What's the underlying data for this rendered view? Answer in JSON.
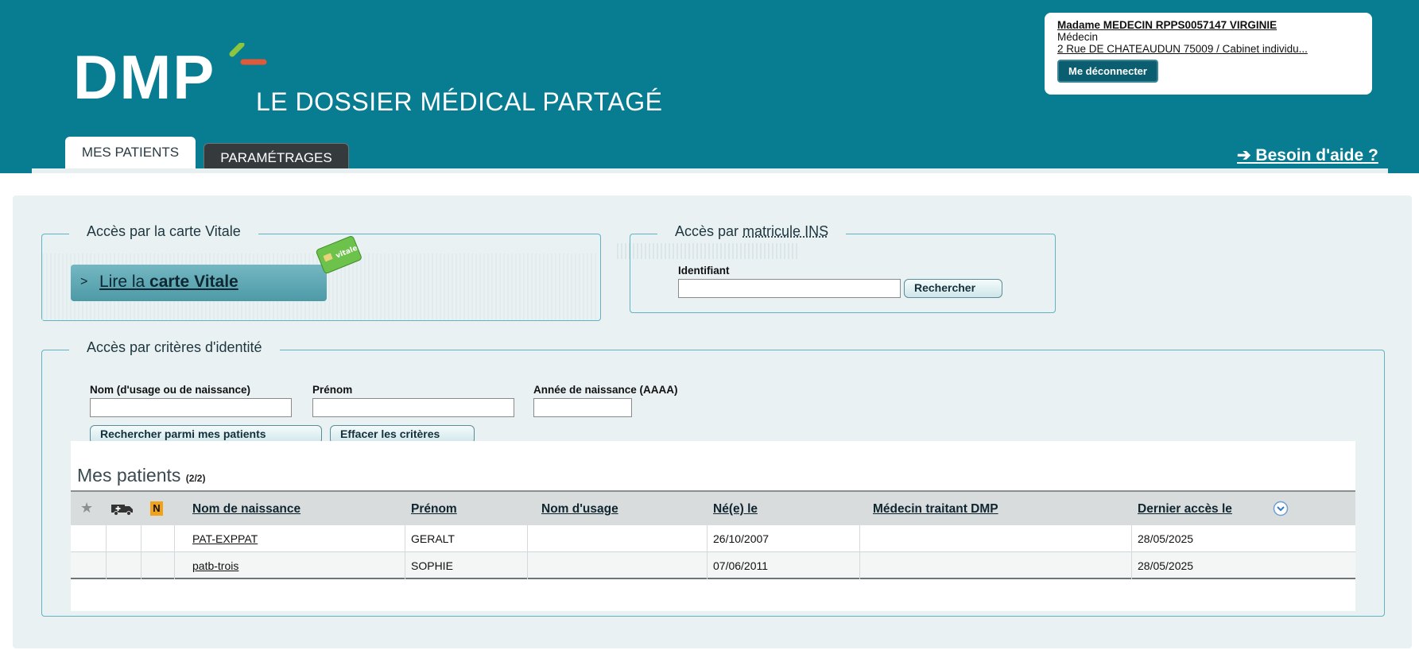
{
  "header": {
    "logo_text": "DMP",
    "tagline": "LE DOSSIER MÉDICAL PARTAGÉ",
    "brand_color": "#087d92",
    "accent_colors": [
      "#e05a3a",
      "#8cc63f"
    ],
    "tabs": [
      {
        "label": "MES PATIENTS",
        "active": true
      },
      {
        "label": "PARAMÉTRAGES",
        "active": false
      }
    ],
    "help_link": "➔ Besoin d'aide ?"
  },
  "user": {
    "name": "Madame MEDECIN RPPS0057147 VIRGINIE",
    "role": "Médecin",
    "address": "2 Rue DE CHATEAUDUN 75009 / Cabinet individu...",
    "logout_label": "Me déconnecter"
  },
  "vitale": {
    "legend": "Accès par la carte Vitale",
    "button_prefix": "Lire la ",
    "button_strong": "carte Vitale",
    "card_text": "vitale"
  },
  "ins": {
    "legend_prefix": "Accès par ",
    "legend_underlined": "matricule INS",
    "id_label": "Identifiant",
    "id_value": "",
    "search_label": "Rechercher"
  },
  "identity": {
    "legend": "Accès par critères d'identité",
    "fields": {
      "nom_label": "Nom (d'usage ou de naissance)",
      "nom_value": "",
      "prenom_label": "Prénom",
      "prenom_value": "",
      "annee_label": "Année de naissance (AAAA)",
      "annee_value": ""
    },
    "search_button": "Rechercher parmi mes patients",
    "clear_button": "Effacer les critères"
  },
  "results": {
    "title": "Mes patients",
    "count": "(2/2)",
    "columns": {
      "favorite": "★",
      "n_badge": "N",
      "nom_naissance": "Nom de naissance",
      "prenom": "Prénom",
      "nom_usage": "Nom d'usage",
      "ne_le": "Né(e) le",
      "medecin": "Médecin traitant DMP",
      "dernier_acces": "Dernier accès le"
    },
    "rows": [
      {
        "nom_naissance": "PAT-EXPPAT",
        "prenom": "GERALT",
        "nom_usage": "",
        "ne_le": "26/10/2007",
        "medecin": "",
        "dernier_acces": "28/05/2025"
      },
      {
        "nom_naissance": "patb-trois",
        "prenom": "SOPHIE",
        "nom_usage": "",
        "ne_le": "07/06/2011",
        "medecin": "",
        "dernier_acces": "28/05/2025"
      }
    ]
  }
}
